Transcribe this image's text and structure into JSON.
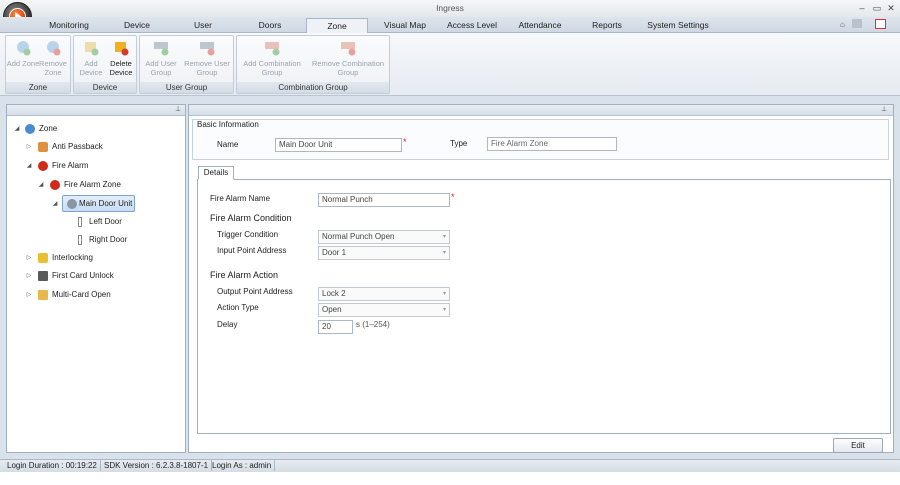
{
  "app_title": "Ingress",
  "window_controls": [
    "–",
    "▭",
    "✕"
  ],
  "tabs": [
    "Monitoring",
    "Device",
    "User",
    "Doors",
    "Zone",
    "Visual Map",
    "Access Level",
    "Attendance",
    "Reports",
    "System Settings"
  ],
  "active_tab": "Zone",
  "ribbon": {
    "zone": {
      "label": "Zone",
      "add": "Add Zone",
      "remove": "Remove Zone"
    },
    "device": {
      "label": "Device",
      "add": "Add Device",
      "delete": "Delete Device"
    },
    "user_group": {
      "label": "User Group",
      "add": "Add User Group",
      "remove": "Remove User Group"
    },
    "combination_group": {
      "label": "Combination Group",
      "add": "Add Combination Group",
      "remove": "Remove Combination Group"
    }
  },
  "tree": {
    "root": "Zone",
    "anti_passback": "Anti Passback",
    "fire_alarm": "Fire Alarm",
    "fire_alarm_zone": "Fire Alarm Zone",
    "main_door_unit": "Main Door Unit",
    "left_door": "Left Door",
    "right_door": "Right Door",
    "interlocking": "Interlocking",
    "first_card_unlock": "First Card Unlock",
    "multi_card_open": "Multi-Card Open"
  },
  "basic_info": {
    "title": "Basic Information",
    "name_label": "Name",
    "name_value": "Main Door Unit",
    "type_label": "Type",
    "type_value": "Fire Alarm Zone"
  },
  "details": {
    "tab": "Details",
    "fire_alarm_name_label": "Fire Alarm Name",
    "fire_alarm_name_value": "Normal Punch",
    "condition_title": "Fire Alarm Condition",
    "trigger_label": "Trigger Condition",
    "trigger_value": "Normal Punch Open",
    "input_label": "Input Point Address",
    "input_value": "Door 1",
    "action_title": "Fire Alarm Action",
    "output_label": "Output Point Address",
    "output_value": "Lock 2",
    "action_type_label": "Action Type",
    "action_type_value": "Open",
    "delay_label": "Delay",
    "delay_value": "20",
    "delay_unit": "s (1–254)"
  },
  "edit_label": "Edit",
  "status": {
    "duration": "Login Duration : 00:19:22",
    "sdk": "SDK Version : 6.2.3.8-1807-1",
    "login_as": "Login As : admin"
  }
}
